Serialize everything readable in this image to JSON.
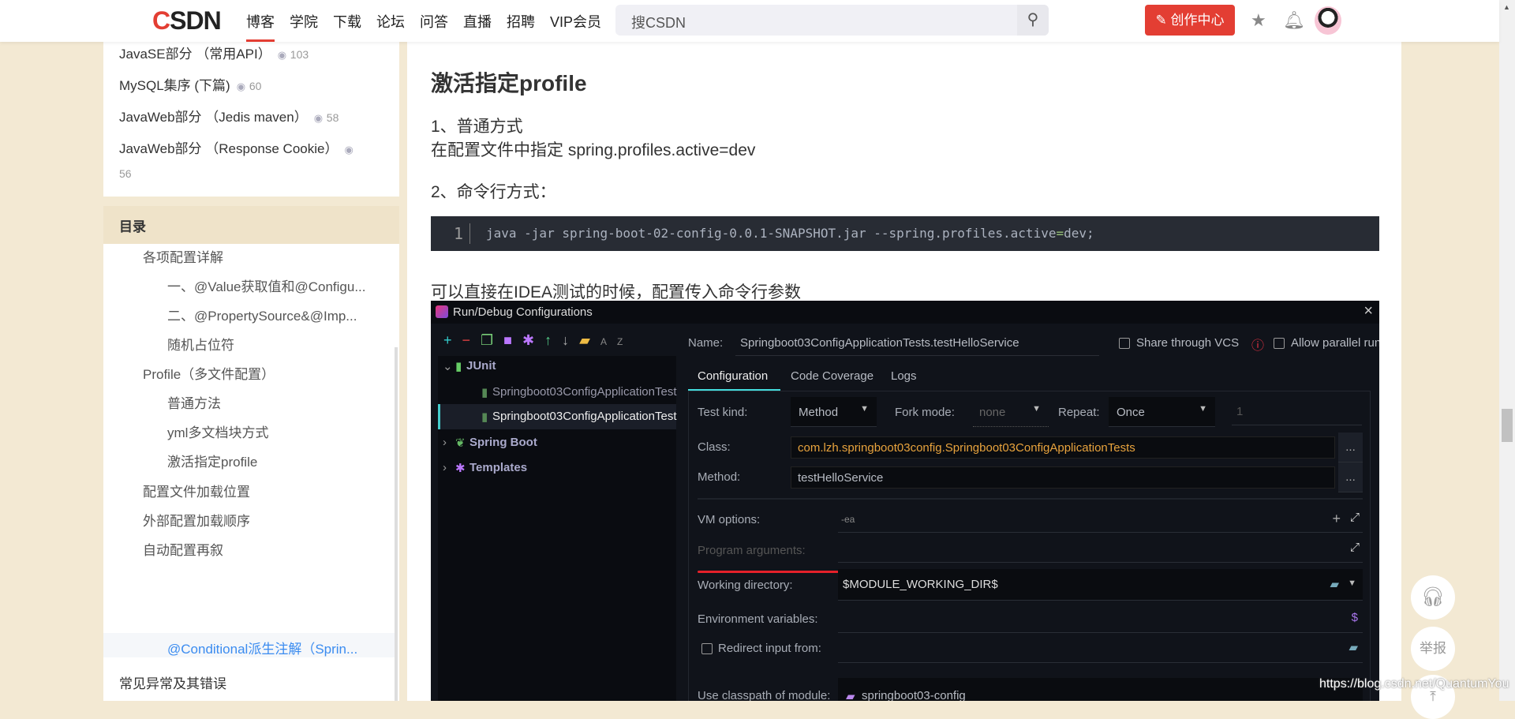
{
  "header": {
    "logo": "CSDN",
    "nav": [
      "博客",
      "学院",
      "下载",
      "论坛",
      "问答",
      "直播",
      "招聘",
      "VIP会员"
    ],
    "active_nav": "博客",
    "search_placeholder": "搜CSDN",
    "create_button": "创作中心",
    "accent": "#e33e33"
  },
  "recent": [
    {
      "title": "JavaSE部分 （常用API）",
      "views": "103"
    },
    {
      "title": "MySQL集序 (下篇)",
      "views": "60"
    },
    {
      "title": "JavaWeb部分 （Jedis maven）",
      "views": "58"
    },
    {
      "title": "JavaWeb部分 （Response Cookie）",
      "views": "56"
    }
  ],
  "toc": {
    "title": "目录",
    "items": [
      {
        "label": "各项配置详解",
        "level": 2
      },
      {
        "label": "一、@Value获取值和@Configu...",
        "level": 3
      },
      {
        "label": "二、@PropertySource&@Imp...",
        "level": 3
      },
      {
        "label": "随机占位符",
        "level": 3
      },
      {
        "label": "Profile（多文件配置）",
        "level": 2
      },
      {
        "label": "普通方法",
        "level": 3
      },
      {
        "label": "yml多文档块方式",
        "level": 3
      },
      {
        "label": "激活指定profile",
        "level": 3
      },
      {
        "label": "配置文件加载位置",
        "level": 2
      },
      {
        "label": "外部配置加载顺序",
        "level": 2
      },
      {
        "label": "自动配置再叙",
        "level": 2
      },
      {
        "label": "@Conditional派生注解（Sprin...",
        "level": 3,
        "active": true
      },
      {
        "label": "常见异常及其错误",
        "level": 1
      }
    ]
  },
  "article": {
    "heading": "激活指定profile",
    "p1": "1、普通方式",
    "p2": "在配置文件中指定 spring.profiles.active=dev",
    "p3": "2、命令行方式：",
    "code": {
      "line": "1",
      "pre": "java -jar spring-boot-02-config-0.0.1-SNAPSHOT.jar --spring.profiles.active",
      "eq": "=",
      "post": "dev;"
    },
    "p4": "可以直接在IDEA测试的时候，配置传入命令行参数"
  },
  "idea": {
    "title": "Run/Debug Configurations",
    "tree": {
      "junit": "JUnit",
      "test1": "Springboot03ConfigApplicationTest",
      "test2": "Springboot03ConfigApplicationTest",
      "springboot": "Spring Boot",
      "templates": "Templates"
    },
    "name_label": "Name:",
    "name_value": "Springboot03ConfigApplicationTests.testHelloService",
    "share_vcs": "Share through VCS",
    "allow_parallel": "Allow parallel run",
    "tabs": [
      "Configuration",
      "Code Coverage",
      "Logs"
    ],
    "test_kind_label": "Test kind:",
    "test_kind": "Method",
    "fork_mode_label": "Fork mode:",
    "fork_mode": "none",
    "repeat_label": "Repeat:",
    "repeat": "Once",
    "repeat_count": "1",
    "class_label": "Class:",
    "class_value": "com.lzh.springboot03config.Springboot03ConfigApplicationTests",
    "method_label": "Method:",
    "method_value": "testHelloService",
    "vm_label": "VM options:",
    "vm_value": "-ea",
    "prog_label": "Program arguments:",
    "workdir_label": "Working directory:",
    "workdir_value": "$MODULE_WORKING_DIR$",
    "env_label": "Environment variables:",
    "redirect_label": "Redirect input from:",
    "classpath_label": "Use classpath of module:",
    "classpath_value": "springboot03-config",
    "more": "..."
  },
  "float": {
    "report": "举报"
  },
  "watermark": "https://blog.csdn.net/QuantumYou"
}
